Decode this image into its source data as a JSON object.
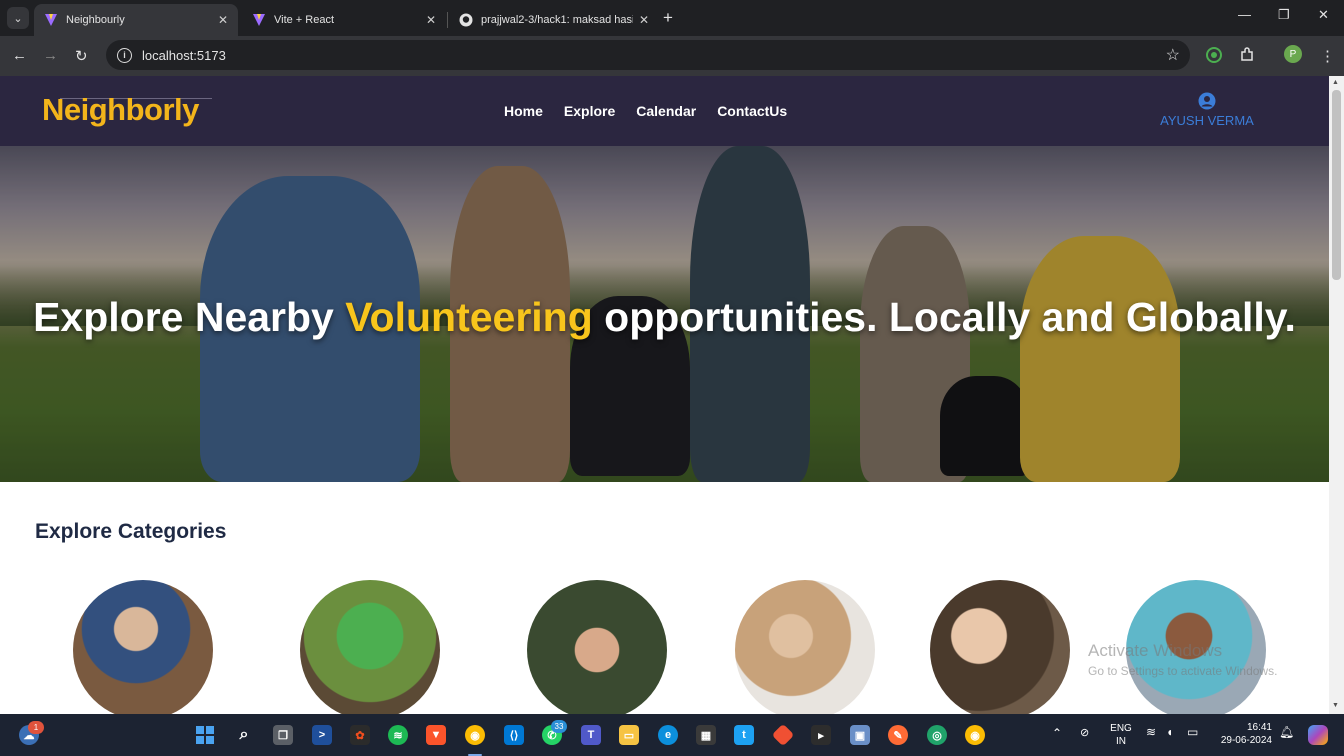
{
  "browser": {
    "tabs": [
      {
        "title": "Neighbourly",
        "active": true
      },
      {
        "title": "Vite + React",
        "active": false
      },
      {
        "title": "prajjwal2-3/hack1: maksad hasi",
        "active": false
      }
    ],
    "url": "localhost:5173",
    "profile_initial": "P"
  },
  "site": {
    "logo": "Neighborly",
    "nav": [
      "Home",
      "Explore",
      "Calendar",
      "ContactUs"
    ],
    "user_name": "AYUSH VERMA"
  },
  "hero": {
    "title_before": "Explore Nearby ",
    "title_highlight": "Volunteering",
    "title_after": " opportunities. Locally and Globally."
  },
  "categories": {
    "heading": "Explore Categories"
  },
  "watermark": {
    "line1": "Activate Windows",
    "line2": "Go to Settings to activate Windows."
  },
  "taskbar": {
    "weather_badge": "1",
    "whatsapp_badge": "33",
    "lang_top": "ENG",
    "lang_bottom": "IN",
    "time": "16:41",
    "date": "29-06-2024"
  },
  "colors": {
    "header_bg": "#2b2640",
    "logo": "#f3b51b",
    "highlight": "#f8c51c",
    "user": "#3b7dd8"
  }
}
